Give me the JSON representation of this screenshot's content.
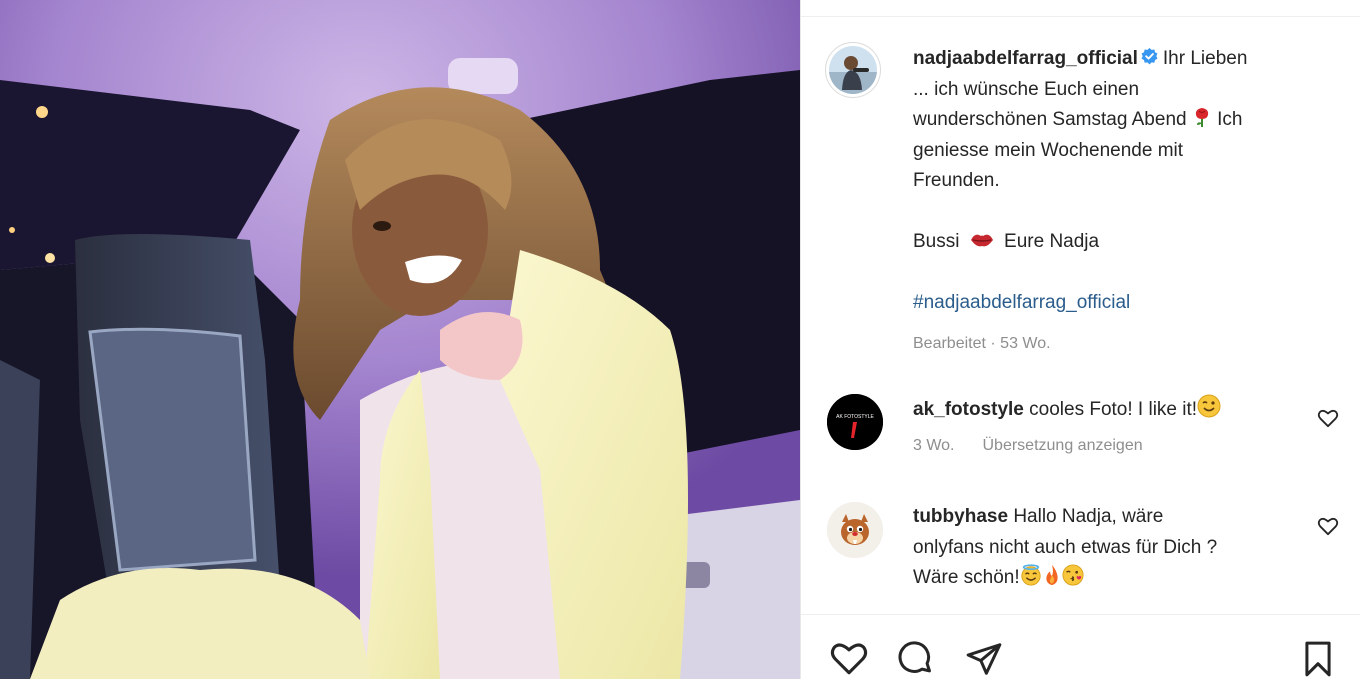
{
  "post": {
    "username": "nadjaabdelfarrag_official",
    "caption_lines": [
      "Ihr Lieben",
      "... ich wünsche Euch einen",
      "wunderschönen Samstag Abend",
      "Ich",
      "geniesse mein Wochenende mit",
      "Freunden."
    ],
    "sign_off_prefix": "Bussi",
    "sign_off_suffix": "Eure Nadja",
    "hashtag": "#nadjaabdelfarrag_official",
    "edited_label": "Bearbeitet",
    "separator": "·",
    "age": "53 Wo."
  },
  "comments": [
    {
      "username": "ak_fotostyle",
      "lines": [
        "cooles Foto! I like it!"
      ],
      "age": "3 Wo.",
      "translate_label": "Übersetzung anzeigen",
      "avatar_text": "AK FOTOSTYLE"
    },
    {
      "username": "tubbyhase",
      "lines": [
        "Hallo Nadja, wäre",
        "onlyfans nicht auch etwas für Dich ?",
        "Wäre schön!"
      ]
    }
  ],
  "icons": {
    "verified": "verified-badge-icon",
    "like": "heart-icon",
    "comment": "comment-bubble-icon",
    "share": "paper-plane-icon",
    "save": "bookmark-icon"
  },
  "colors": {
    "verified_blue": "#3897f0",
    "hashtag": "#2b5d8c",
    "muted_text": "#8e8e8e"
  }
}
